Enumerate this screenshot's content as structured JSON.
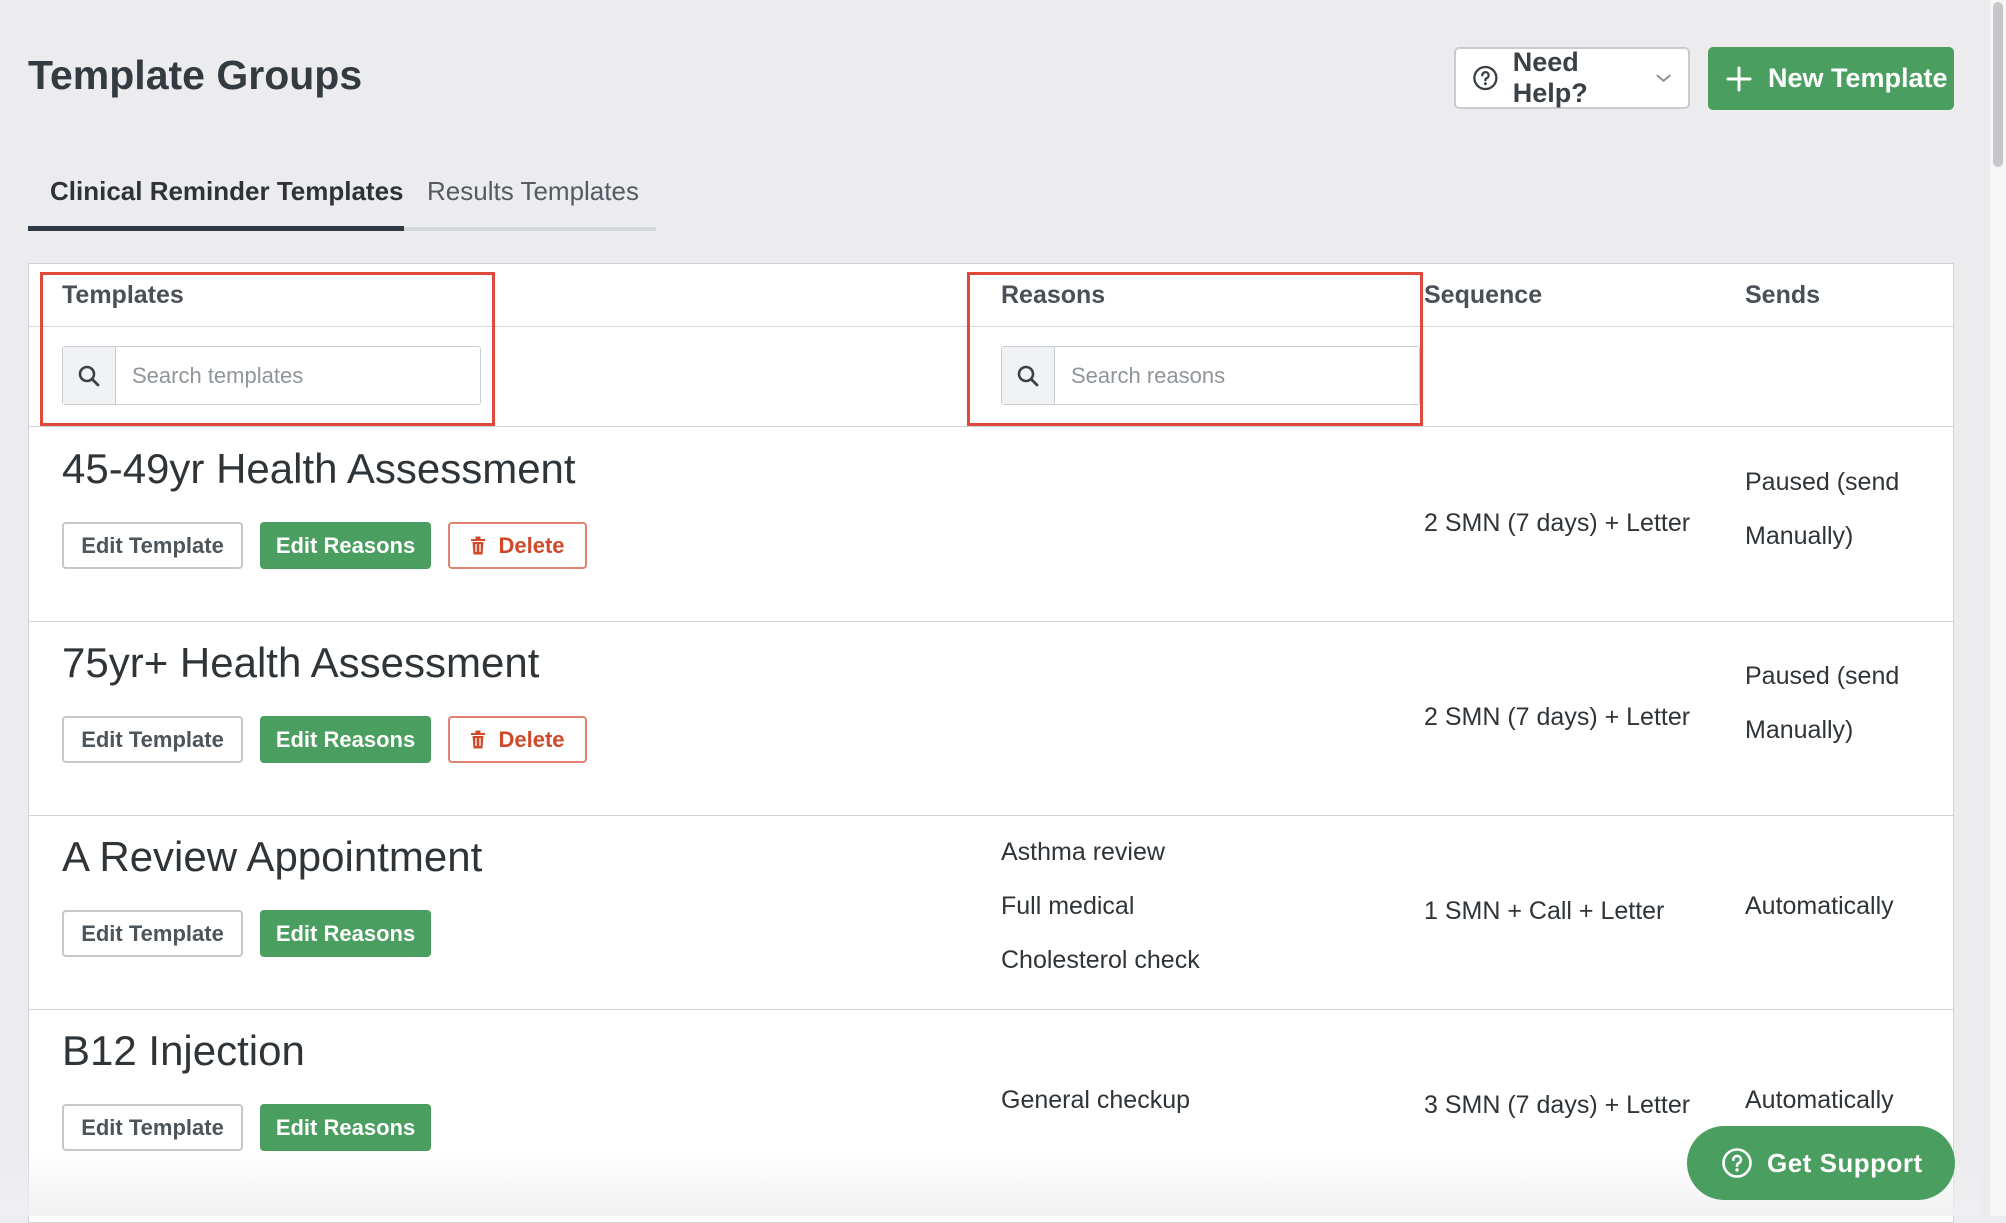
{
  "header": {
    "title": "Template Groups",
    "help_label": "Need Help?",
    "new_template_label": "New Template"
  },
  "tabs": [
    {
      "label": "Clinical Reminder Templates",
      "active": true
    },
    {
      "label": "Results Templates",
      "active": false
    }
  ],
  "table": {
    "columns": {
      "templates": "Templates",
      "reasons": "Reasons",
      "sequence": "Sequence",
      "sends": "Sends"
    },
    "search": {
      "templates_placeholder": "Search templates",
      "reasons_placeholder": "Search reasons"
    },
    "buttons": {
      "edit_template": "Edit Template",
      "edit_reasons": "Edit Reasons",
      "delete": "Delete"
    },
    "rows": [
      {
        "name": "45-49yr Health Assessment",
        "reasons": [],
        "sequence": "2 SMN (7 days) + Letter",
        "sends_line1": "Paused (send",
        "sends_line2": "Manually)",
        "deletable": true
      },
      {
        "name": "75yr+ Health Assessment",
        "reasons": [],
        "sequence": "2 SMN (7 days) + Letter",
        "sends_line1": "Paused (send",
        "sends_line2": "Manually)",
        "deletable": true
      },
      {
        "name": "A Review Appointment",
        "reasons": [
          "Asthma review",
          "Full medical",
          "Cholesterol check"
        ],
        "sequence": "1 SMN + Call + Letter",
        "sends_line1": "Automatically",
        "sends_line2": "",
        "deletable": false
      },
      {
        "name": "B12 Injection",
        "reasons": [
          "General checkup"
        ],
        "sequence": "3 SMN (7 days) + Letter",
        "sends_line1": "Automatically",
        "sends_line2": "",
        "deletable": false
      }
    ]
  },
  "support": {
    "label": "Get Support"
  },
  "colors": {
    "primary_green": "#4a9e5f",
    "highlight_red": "#e0483a",
    "delete_red": "#d04a2a"
  },
  "icons": {
    "help": "question-circle-icon",
    "new": "plus-icon",
    "search": "search-icon",
    "delete": "trash-icon",
    "support": "question-circle-icon"
  }
}
